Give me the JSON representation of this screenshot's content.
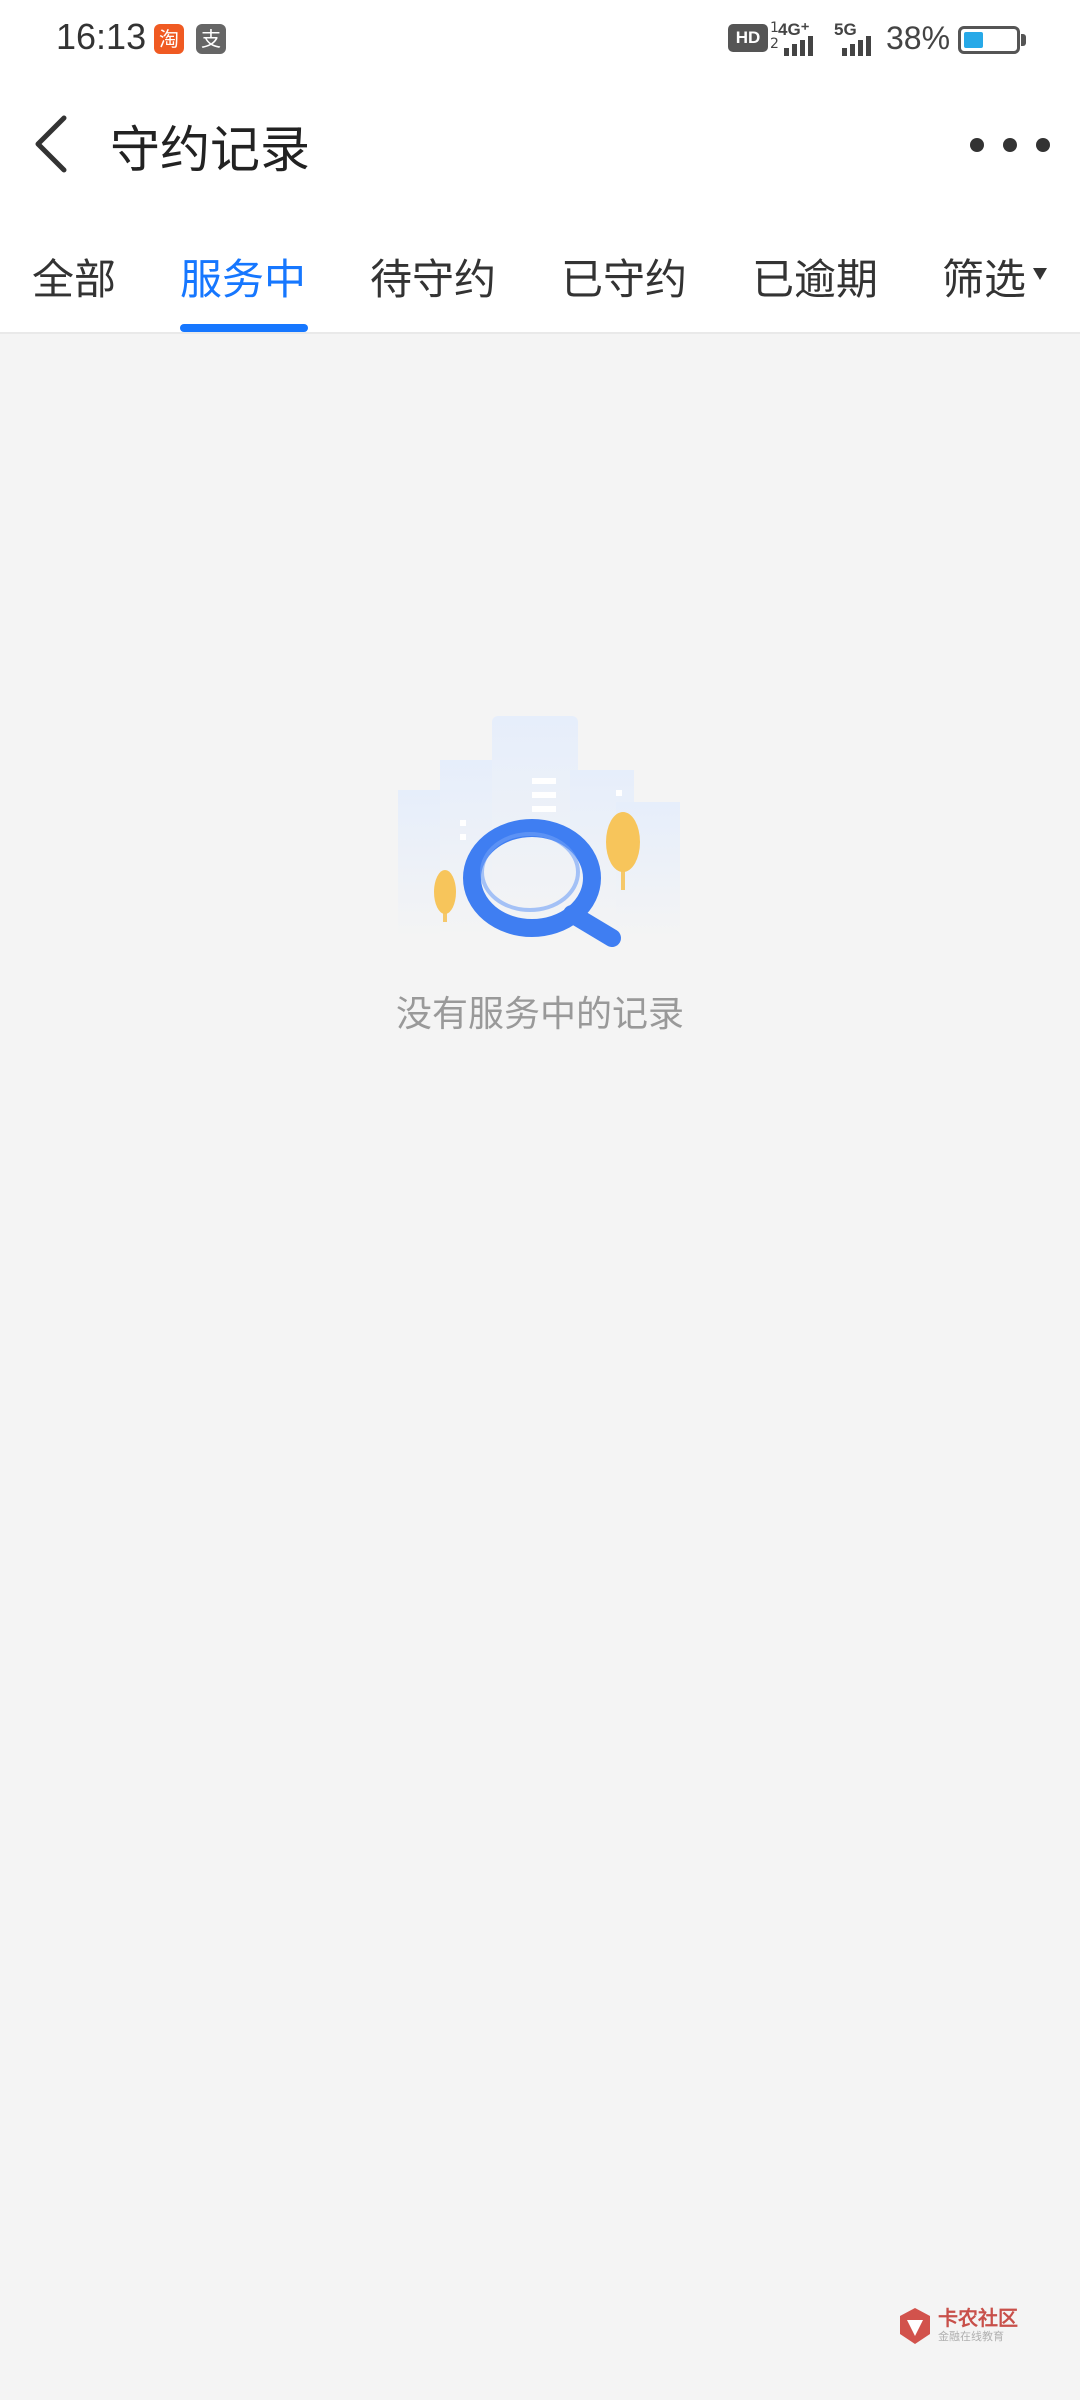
{
  "status_bar": {
    "time": "16:13",
    "app_icons": [
      "淘",
      "支"
    ],
    "hd_label": "HD",
    "hd_sub": [
      "1",
      "2"
    ],
    "network_1": "4G⁺",
    "network_2": "5G",
    "battery_percent": "38%",
    "battery_level": 0.38,
    "accent": "#27a9e8"
  },
  "header": {
    "title": "守约记录",
    "back_icon": "chevron-left-icon",
    "more_icon": "more-dots-icon"
  },
  "tabs": {
    "items": [
      {
        "label": "全部"
      },
      {
        "label": "服务中"
      },
      {
        "label": "待守约"
      },
      {
        "label": "已守约"
      },
      {
        "label": "已逾期"
      }
    ],
    "active": "服务中",
    "active_color": "#1677ff",
    "filter_label": "筛选"
  },
  "empty_state": {
    "icon": "magnifier-empty-illustration",
    "message": "没有服务中的记录"
  },
  "watermark": {
    "text": "卡农社区",
    "subtext": "金融在线教育"
  }
}
